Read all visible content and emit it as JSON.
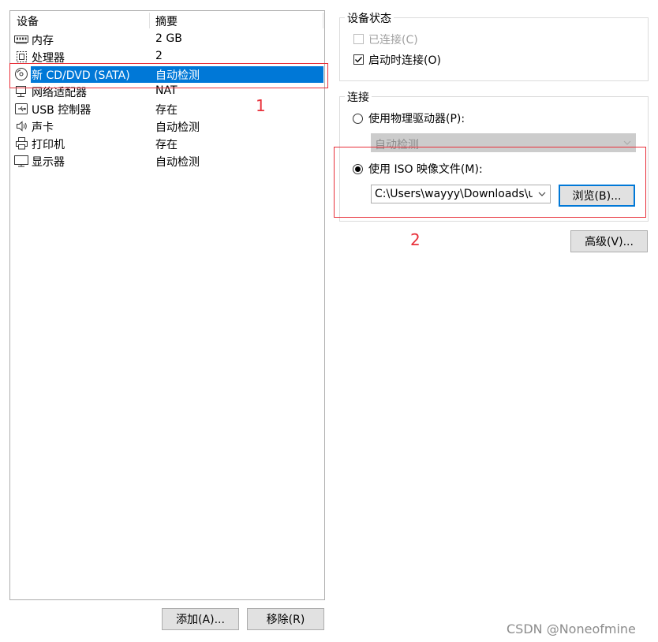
{
  "device_list": {
    "columns": {
      "device": "设备",
      "summary": "摘要"
    },
    "rows": [
      {
        "name": "内存",
        "summary": "2 GB",
        "icon": "memory-icon"
      },
      {
        "name": "处理器",
        "summary": "2",
        "icon": "cpu-icon"
      },
      {
        "name": "新 CD/DVD (SATA)",
        "summary": "自动检测",
        "icon": "cd-dvd-icon",
        "selected": true
      },
      {
        "name": "网络适配器",
        "summary": "NAT",
        "icon": "network-adapter-icon"
      },
      {
        "name": "USB 控制器",
        "summary": "存在",
        "icon": "usb-icon"
      },
      {
        "name": "声卡",
        "summary": "自动检测",
        "icon": "speaker-icon"
      },
      {
        "name": "打印机",
        "summary": "存在",
        "icon": "printer-icon"
      },
      {
        "name": "显示器",
        "summary": "自动检测",
        "icon": "monitor-icon"
      }
    ],
    "add_button": "添加(A)...",
    "remove_button": "移除(R)"
  },
  "device_status": {
    "title": "设备状态",
    "connected_label": "已连接(C)",
    "connected_checked": false,
    "connected_enabled": false,
    "connect_at_power_on_label": "启动时连接(O)",
    "connect_at_power_on_checked": true
  },
  "connection": {
    "title": "连接",
    "physical_drive_label": "使用物理驱动器(P):",
    "physical_drive_selected": false,
    "physical_drive_value": "自动检测",
    "iso_label": "使用 ISO 映像文件(M):",
    "iso_selected": true,
    "iso_path": "C:\\Users\\wayyy\\Downloads\\ubuntu",
    "browse_button": "浏览(B)..."
  },
  "advanced_button": "高级(V)...",
  "annotations": {
    "marker_1": "1",
    "marker_2": "2",
    "color": "#e8303a"
  },
  "watermark": "CSDN @Noneofmine",
  "colors": {
    "selection": "#0078d7",
    "button_bg": "#e1e1e1",
    "annotation": "#e8303a"
  }
}
